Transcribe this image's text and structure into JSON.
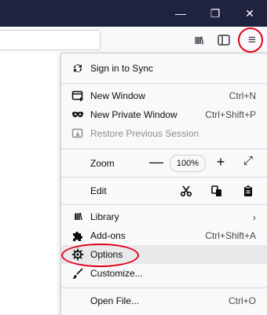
{
  "window": {
    "minimize_glyph": "—",
    "maximize_glyph": "❐",
    "close_glyph": "✕"
  },
  "toolbar": {
    "library_glyph": "III\\",
    "menu_glyph": "≡"
  },
  "menu": {
    "sync": {
      "label": "Sign in to Sync",
      "icon": "sync-icon"
    },
    "new_window": {
      "label": "New Window",
      "shortcut": "Ctrl+N",
      "icon": "new-window-icon"
    },
    "private_window": {
      "label": "New Private Window",
      "shortcut": "Ctrl+Shift+P",
      "icon": "private-mask-icon"
    },
    "restore_session": {
      "label": "Restore Previous Session",
      "icon": "restore-session-icon",
      "disabled": true
    },
    "zoom": {
      "label": "Zoom",
      "minus": "—",
      "value": "100%",
      "plus": "+",
      "fullscreen": "⤢"
    },
    "edit": {
      "label": "Edit",
      "cut_icon": "scissors-icon",
      "copy_icon": "copy-icon",
      "paste_icon": "clipboard-icon"
    },
    "library": {
      "label": "Library",
      "chevron": "›",
      "icon": "library-icon"
    },
    "addons": {
      "label": "Add-ons",
      "shortcut": "Ctrl+Shift+A",
      "icon": "puzzle-icon"
    },
    "options": {
      "label": "Options",
      "icon": "gear-icon"
    },
    "customize": {
      "label": "Customize...",
      "icon": "brush-icon"
    },
    "open_file": {
      "label": "Open File...",
      "shortcut": "Ctrl+O"
    }
  },
  "colors": {
    "titlebar": "#202340",
    "highlight": "#e3001b"
  }
}
